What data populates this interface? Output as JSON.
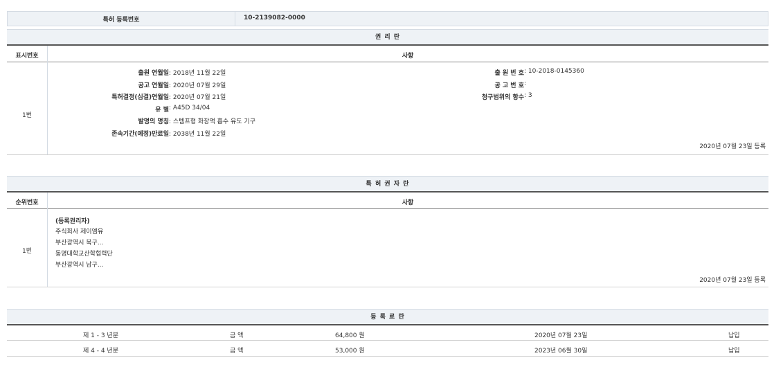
{
  "reg": {
    "label": "특허 등록번호",
    "value": "10-2139082-0000"
  },
  "section1": {
    "title": "권 리 란",
    "col_no": "표시번호",
    "col_content": "사항",
    "row_no": "1번",
    "left_fields": [
      {
        "label": "출원 연월일",
        "value": "2018년 11월 22일"
      },
      {
        "label": "공고 연월일",
        "value": "2020년 07월 29일"
      },
      {
        "label": "특허결정(심결)연월일",
        "value": "2020년 07월 21일"
      },
      {
        "label": "유 별",
        "value": "A45D 34/04"
      },
      {
        "label": "발명의 명칭",
        "value": "스템프형 화장액 흡수 유도 기구"
      },
      {
        "label": "존속기간(예정)만료일",
        "value": "2038년 11월 22일"
      }
    ],
    "right_fields": [
      {
        "label": "출 원 번 호",
        "value": "10-2018-0145360"
      },
      {
        "label": "공 고 번 호",
        "value": ""
      },
      {
        "label": "청구범위의 항수",
        "value": "3"
      }
    ],
    "sep": " : ",
    "reg_date": "2020년 07월 23일 등록"
  },
  "section2": {
    "title": "특 허 권 자 란",
    "col_no": "순위번호",
    "col_content": "사항",
    "row_no": "1번",
    "lines": [
      "(등록권리자)",
      "주식회사 제이엠유",
      "부산광역시 북구...",
      "동명대학교산학협력단",
      "부산광역시 남구..."
    ],
    "reg_date": "2020년 07월 23일 등록"
  },
  "section3": {
    "title": "등 록 료 란",
    "rows": [
      {
        "period": "제 1 - 3 년분",
        "label": "금 액",
        "amount": "64,800 원",
        "date": "2020년 07월 23일",
        "status": "납입"
      },
      {
        "period": "제 4 - 4 년분",
        "label": "금 액",
        "amount": "53,000 원",
        "date": "2023년 06월 30일",
        "status": "납입"
      }
    ]
  }
}
